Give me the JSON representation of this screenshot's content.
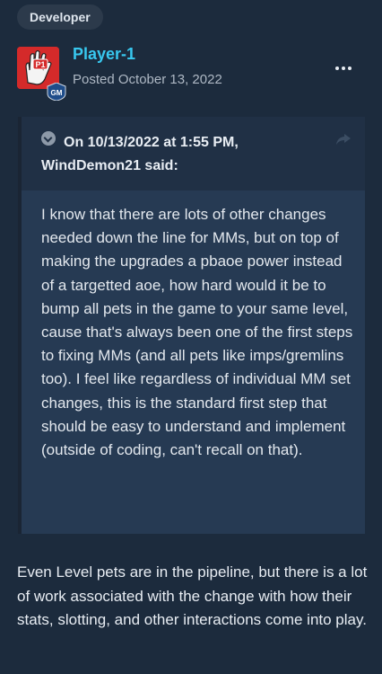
{
  "badge": "Developer",
  "post": {
    "author": "Player-1",
    "posted": "Posted October 13, 2022",
    "avatar_text": "P1",
    "avatar_badge": "GM",
    "more_icon": "more-options-icon"
  },
  "quote": {
    "header_date": "On 10/13/2022 at 1:55 PM,",
    "header_author": "WindDemon21 said:",
    "collapse_icon": "chevron-down-circle-icon",
    "share_icon": "share-arrow-icon",
    "body": "I know that there are lots of other changes needed down the line for MMs, but on top of making the upgrades a pbaoe power instead of a targetted aoe, how hard would it be to bump all  pets in the game to your same level, cause that's always been one of the first steps to fixing MMs (and all pets like imps/gremlins too). I feel like regardless of individual MM set changes, this is the standard first step that should be easy to understand and implement (outside of coding, can't recall on that)."
  },
  "reply": "Even Level pets are in the pipeline, but there is a lot of work associated with the change with how their stats, slotting, and other interactions come into play.",
  "colors": {
    "background": "#1c2b3d",
    "author": "#38c8ef",
    "quote_bg": "#263a53",
    "quote_header_bg": "#203045"
  }
}
